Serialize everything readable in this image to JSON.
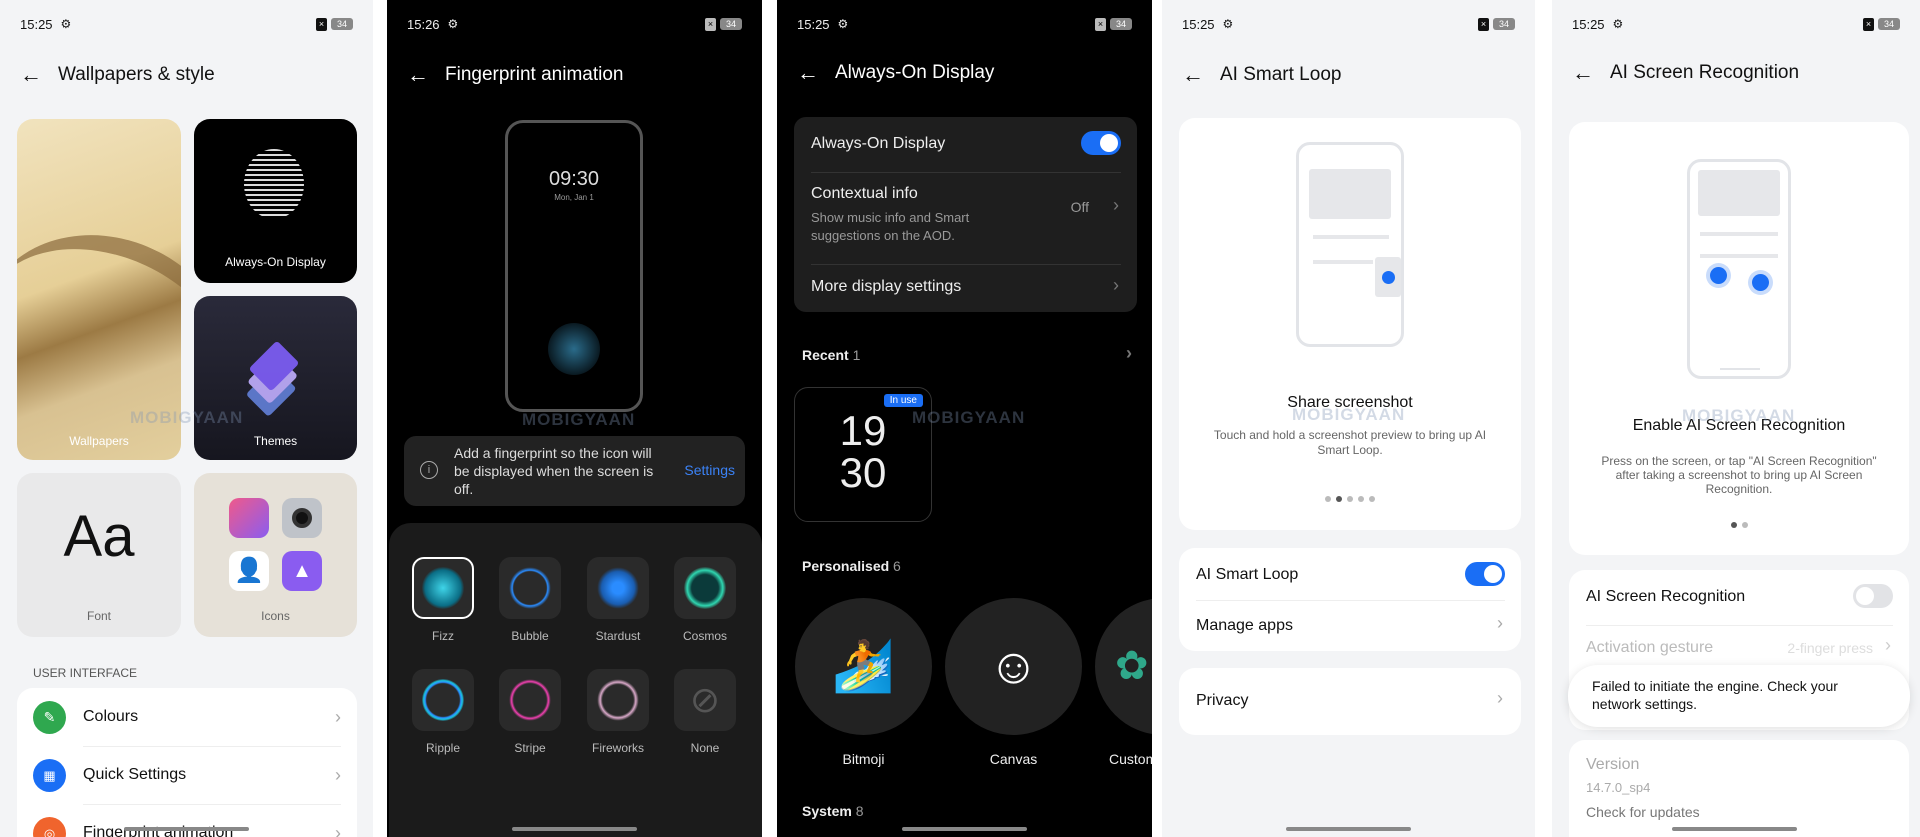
{
  "watermark": "MOBIGYAAN",
  "accent": "#1a6ef5",
  "p1": {
    "time": "15:25",
    "battery": "34",
    "title": "Wallpapers & style",
    "tiles": {
      "wallpapers": "Wallpapers",
      "aod": "Always-On Display",
      "themes": "Themes",
      "font": "Font",
      "font_sample": "Aa",
      "icons": "Icons"
    },
    "section": "USER INTERFACE",
    "items": [
      {
        "label": "Colours",
        "color": "#2fa84f"
      },
      {
        "label": "Quick Settings",
        "color": "#1a6ef5"
      },
      {
        "label": "Fingerprint animation",
        "color": "#f0642d"
      }
    ]
  },
  "p2": {
    "time": "15:26",
    "battery": "34",
    "title": "Fingerprint animation",
    "clock": "09:30",
    "date": "Mon, Jan 1",
    "info": "Add a fingerprint so the icon will be displayed when the screen is off.",
    "settings": "Settings",
    "animations": [
      {
        "label": "Fizz",
        "selected": true
      },
      {
        "label": "Bubble"
      },
      {
        "label": "Stardust"
      },
      {
        "label": "Cosmos"
      },
      {
        "label": "Ripple"
      },
      {
        "label": "Stripe"
      },
      {
        "label": "Fireworks"
      },
      {
        "label": "None"
      }
    ]
  },
  "p3": {
    "time": "15:25",
    "battery": "34",
    "title": "Always-On Display",
    "aod_label": "Always-On Display",
    "aod_on": true,
    "ctx_label": "Contextual info",
    "ctx_desc": "Show music info and Smart suggestions on the AOD.",
    "ctx_value": "Off",
    "more": "More display settings",
    "recent": "Recent",
    "recent_count": "1",
    "in_use": "In use",
    "face_h": "19",
    "face_m": "30",
    "personalised": "Personalised",
    "personalised_count": "6",
    "faces": [
      "Bitmoji",
      "Canvas",
      "Custom"
    ],
    "system": "System",
    "system_count": "8"
  },
  "p4": {
    "time": "15:25",
    "battery": "34",
    "title": "AI Smart Loop",
    "card_title": "Share screenshot",
    "card_desc": "Touch and hold a screenshot preview to bring up AI Smart Loop.",
    "pages": 5,
    "active_page": 2,
    "toggle_label": "AI Smart Loop",
    "toggle_on": true,
    "manage": "Manage apps",
    "privacy": "Privacy"
  },
  "p5": {
    "time": "15:25",
    "battery": "34",
    "title": "AI Screen Recognition",
    "card_title": "Enable AI Screen Recognition",
    "card_desc": "Press on the screen, or tap \"AI Screen Recognition\" after taking a screenshot to bring up AI Screen Recognition.",
    "pages": 2,
    "active_page": 1,
    "toggle_label": "AI Screen Recognition",
    "toggle_on": false,
    "gesture": "Activation gesture",
    "gesture_value": "2-finger press",
    "toast": "Failed to initiate the engine. Check your network settings.",
    "version_label": "Version",
    "version": "14.7.0_sp4",
    "check": "Check for updates"
  }
}
